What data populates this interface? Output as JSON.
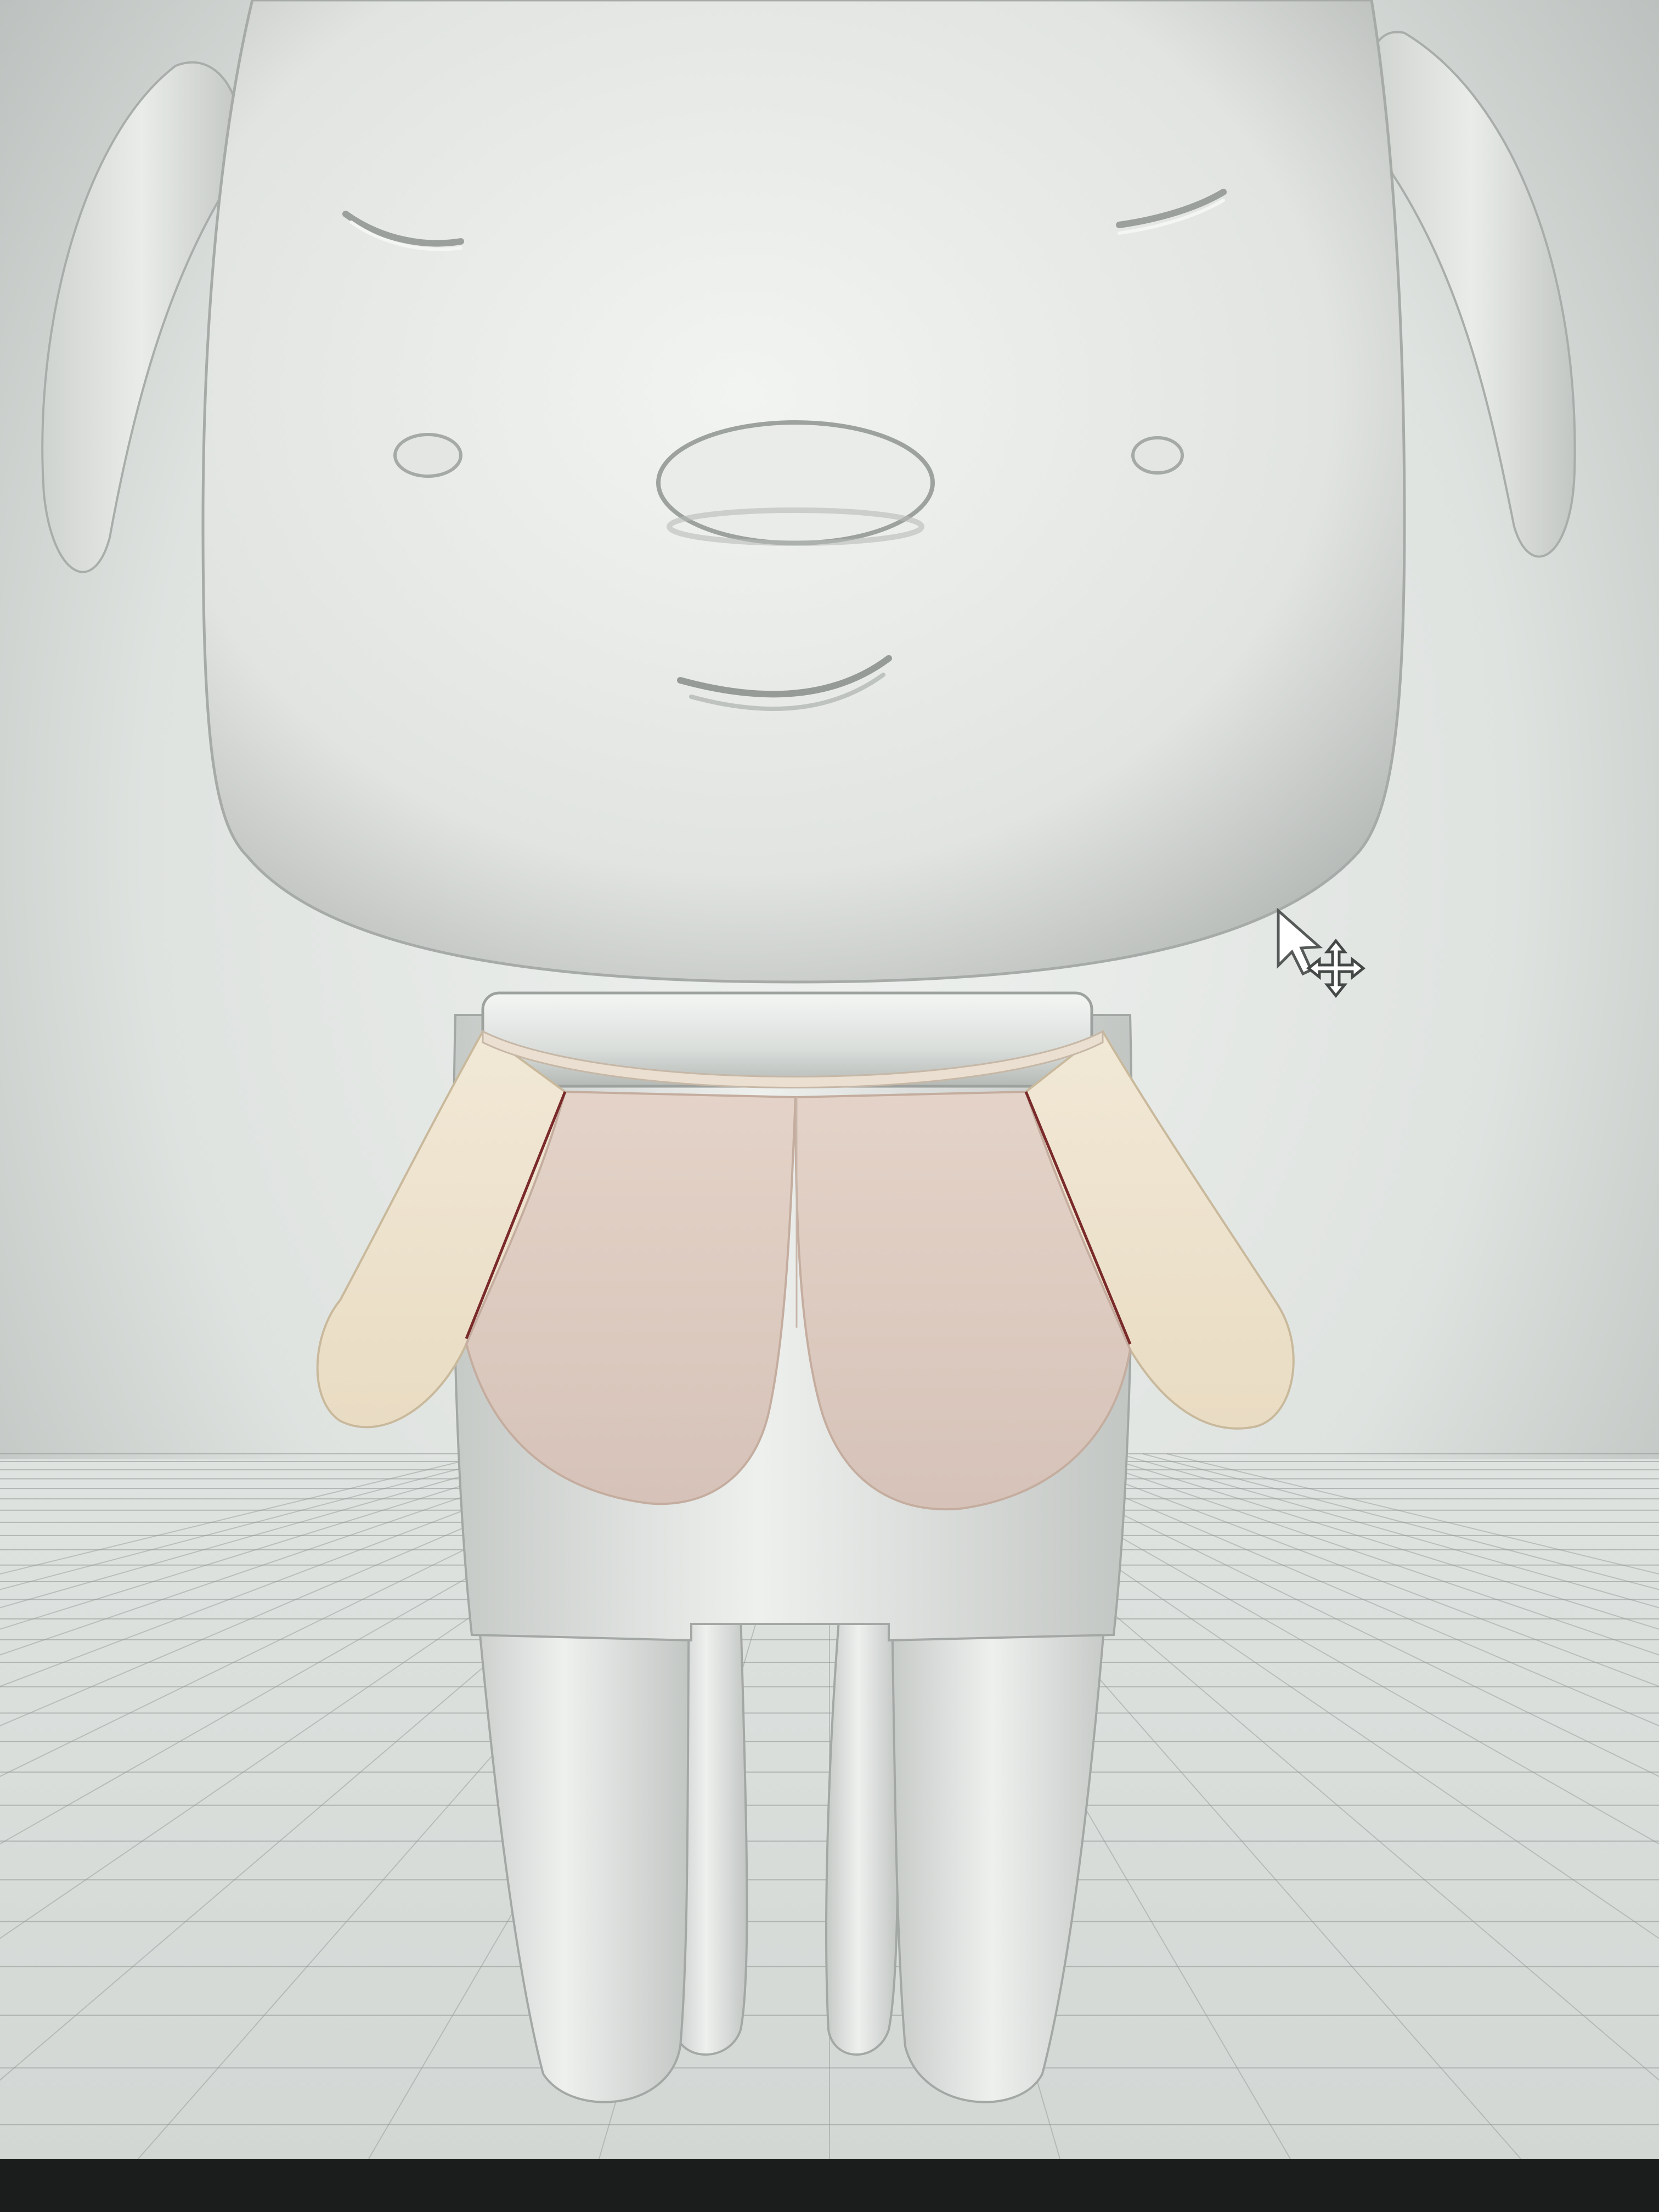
{
  "viewport": {
    "background_top": "#9ea2a0",
    "background_mid": "#dfe3e0",
    "background_bottom": "#d4d8d5",
    "grid_line_color": "#8f9592",
    "model_color": "#e6e9e6",
    "model_shadow": "#b9bdba",
    "cape_color_outer": "#efe4cf",
    "cape_color_inner": "#dcc8bd",
    "seam_color": "#7a2a2a",
    "bottom_bezel": "#1b1c1c"
  },
  "objects": {
    "character_model": "character-model",
    "grid_floor": "grid-floor",
    "cape": "cape-mesh"
  },
  "cursor": {
    "pointer_icon": "arrow-cursor-icon",
    "move_icon": "move-cross-icon"
  }
}
